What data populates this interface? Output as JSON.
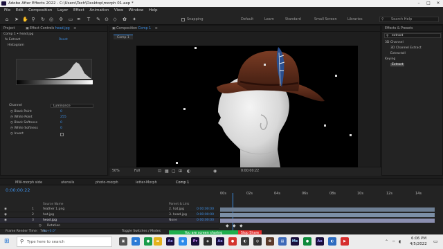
{
  "window": {
    "title": "Adobe After Effects 2022 - C:\\Users\\Tech\\Desktop\\morph 01.aep *"
  },
  "menu": [
    "File",
    "Edit",
    "Composition",
    "Layer",
    "Effect",
    "Animation",
    "View",
    "Window",
    "Help"
  ],
  "toolbar": {
    "snapping": "Snapping",
    "workspaces": [
      "Default",
      "Learn",
      "Standard",
      "Small Screen",
      "Libraries"
    ],
    "search_help": "Search Help"
  },
  "effect_controls": {
    "tab_project": "Project",
    "tab_label": "Effect Controls",
    "tab_file": "head.jpg",
    "layer_path": "Comp 1 • head.jpg",
    "effect_name": "Extract",
    "reset": "Reset",
    "histogram_label": "Histogram",
    "channel_label": "Channel",
    "channel_value": "Luminance",
    "params": [
      {
        "label": "Black Point",
        "value": "0"
      },
      {
        "label": "White Point",
        "value": "255"
      },
      {
        "label": "Black Softness",
        "value": "0"
      },
      {
        "label": "White Softness",
        "value": "0"
      },
      {
        "label": "Invert",
        "value": ""
      }
    ]
  },
  "composition": {
    "tab_label": "Composition",
    "tab_name": "Comp 1",
    "viewer_tab": "Comp 1",
    "zoom": "50%",
    "resolution": "Full",
    "timecode": "0:00:00:22"
  },
  "effects_presets": {
    "title": "Effects & Presets",
    "search_value": "extract",
    "items": [
      "3D Channel",
      "3D Channel Extract",
      "Extractoll",
      "Keying",
      "Extract"
    ]
  },
  "timeline": {
    "tabs": [
      "MW-morph side",
      "utensils",
      "photo-morph",
      "letter-Morph",
      "Comp 1"
    ],
    "current_time": "0:00:00:22",
    "columns": {
      "source_name": "Source Name",
      "parent": "Parent & Link"
    },
    "layers": [
      {
        "num": "1",
        "name": "feather 1.png",
        "parent": "2. hat.jpg",
        "time": "0:00:00:00"
      },
      {
        "num": "2",
        "name": "hat.jpg",
        "parent": "3. head.jpg",
        "time": "0:00:00:00"
      },
      {
        "num": "3",
        "name": "head.jpg",
        "parent": "None",
        "time": "0:00:00:00"
      }
    ],
    "rotation_label": "Rotation",
    "rotation_value": "0x+0.0°",
    "ruler": [
      "00s",
      "02s",
      "04s",
      "06s",
      "08s",
      "10s",
      "12s",
      "14s"
    ],
    "frame_render": "Frame Render Time:",
    "frame_render_value": "7ms",
    "toggle_switches": "Toggle Switches / Modes"
  },
  "screen_share": {
    "message": "You are screen sharing",
    "stop_label": "Stop Share"
  },
  "taskbar": {
    "search_placeholder": "Type here to search",
    "time": "6:06 PM",
    "date": "4/5/2022"
  },
  "colors": {
    "accent": "#2d8ceb",
    "share_green": "#1fae4c",
    "stop_red": "#e5302f",
    "hat_brown": "#5a2b1a"
  }
}
